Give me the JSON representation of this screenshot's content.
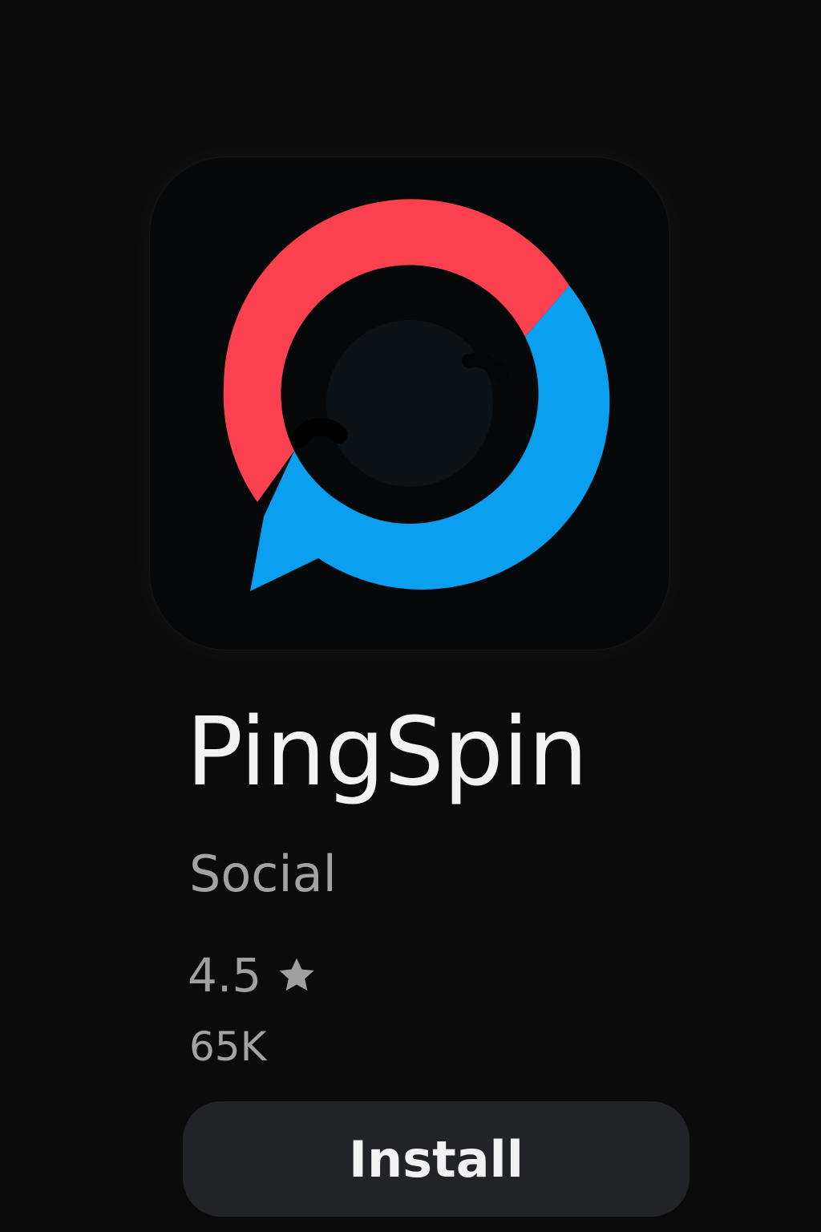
{
  "app": {
    "name": "PingSpin",
    "category": "Social",
    "rating": "4.5",
    "downloads": "65K",
    "icon": {
      "name": "pingspin-logo-icon",
      "colors": {
        "red": "#fb4050",
        "blue": "#0aa0ef",
        "background": "#060809",
        "center": "#0d1217"
      }
    }
  },
  "actions": {
    "install_label": "Install"
  },
  "icons": {
    "rating": "star-icon"
  }
}
